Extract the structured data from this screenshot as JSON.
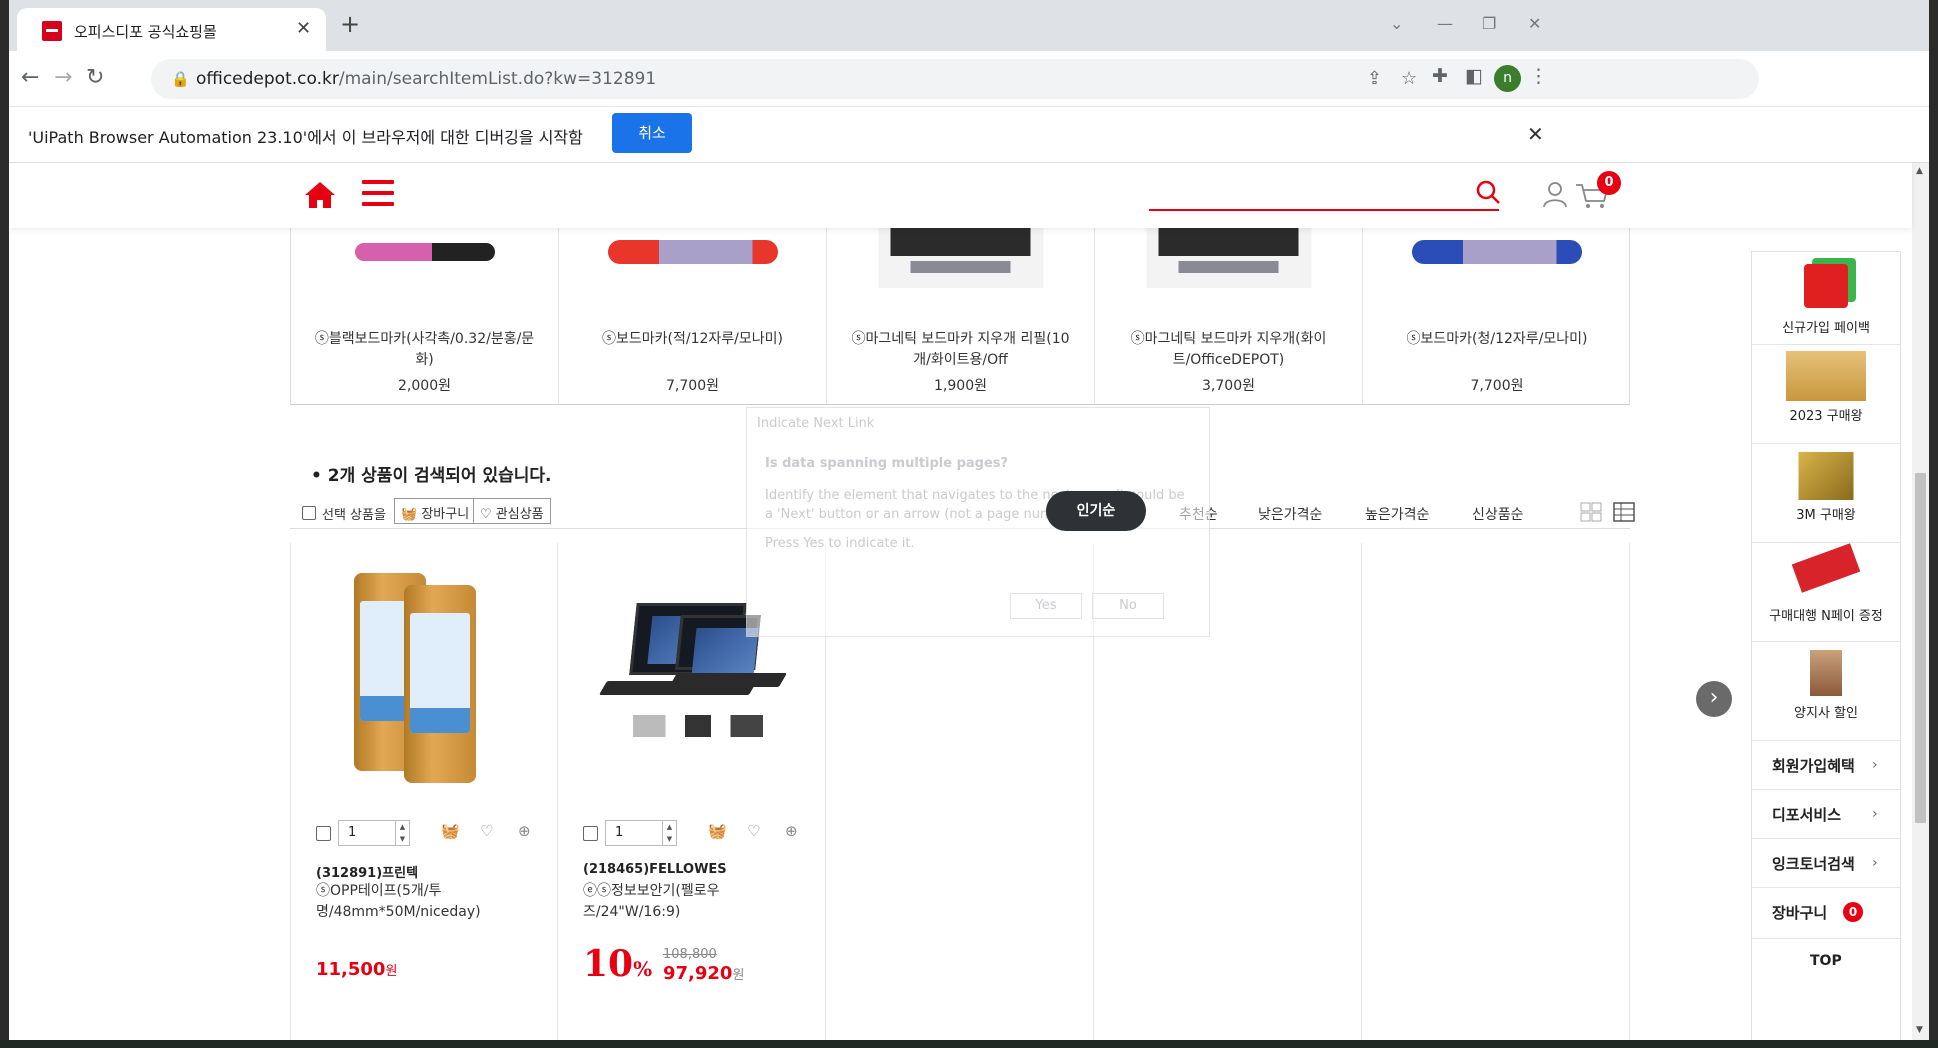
{
  "browser": {
    "tab_title": "오피스디포 공식쇼핑몰",
    "tab_close": "✕",
    "new_tab": "+",
    "url_domain": "officedepot.co.kr",
    "url_path": "/main/searchItemList.do?kw=312891",
    "profile_initial": "n",
    "infobar_message": "'UiPath Browser Automation 23.10'에서 이 브라우저에 대한 디버깅을 시작함",
    "infobar_cancel": "취소",
    "infobar_close": "✕"
  },
  "header": {
    "cart_count": "0",
    "accent_color": "#e60012"
  },
  "top_products": [
    {
      "name": "ⓢ블랙보드마카(사각촉/0.32/분홍/문화)",
      "price": "2,000원",
      "image": "pink-marker"
    },
    {
      "name": "ⓢ보드마카(적/12자루/모나미)",
      "price": "7,700원",
      "image": "red-marker"
    },
    {
      "name": "ⓢ마그네틱 보드마카 지우개 리필(10개/화이트용/Off",
      "price": "1,900원",
      "image": "eraser"
    },
    {
      "name": "ⓢ마그네틱 보드마카 지우개(화이트/OfficeDEPOT)",
      "price": "3,700원",
      "image": "eraser"
    },
    {
      "name": "ⓢ보드마카(청/12자루/모나미)",
      "price": "7,700원",
      "image": "blue-marker"
    }
  ],
  "results": {
    "count_text": "• 2개 상품이 검색되어 있습니다.",
    "select_label": "선택 상품을",
    "cart_button": "장바구니",
    "wish_button": "관심상품",
    "sort_options": [
      "인기순",
      "추천순",
      "낮은가격순",
      "높은가격순",
      "신상품순"
    ],
    "sort_active": "인기순"
  },
  "products": [
    {
      "qty": "1",
      "brand": "(312891)프린텍",
      "name": "ⓢOPP테이프(5개/투명/48mm*50M/niceday)",
      "price": "11,500",
      "currency": "원"
    },
    {
      "qty": "1",
      "brand": "(218465)FELLOWES",
      "name": "ⓔⓢ정보보안기(펠로우즈/24\"W/16:9)",
      "discount": "10",
      "discount_unit": "%",
      "old_price": "108,800",
      "price": "97,920",
      "currency": "원"
    }
  ],
  "side_panel": {
    "promos": [
      {
        "label": "신규가입 페이백"
      },
      {
        "label": "2023 구매왕"
      },
      {
        "label": "3M 구매왕"
      },
      {
        "label": "구매대행 N페이 증정"
      },
      {
        "label": "양지사 할인"
      }
    ],
    "links": [
      "회원가입혜택",
      "디포서비스",
      "잉크토너검색",
      "장바구니"
    ],
    "cart_badge": "0",
    "top_label": "TOP"
  },
  "overlay": {
    "header": "Indicate Next Link",
    "question": "Is data spanning multiple pages?",
    "description": "Identify the element that navigates to the next page. It could be a 'Next' button or an arrow (not a page number).",
    "prompt": "Press Yes to indicate it.",
    "yes": "Yes",
    "no": "No"
  }
}
